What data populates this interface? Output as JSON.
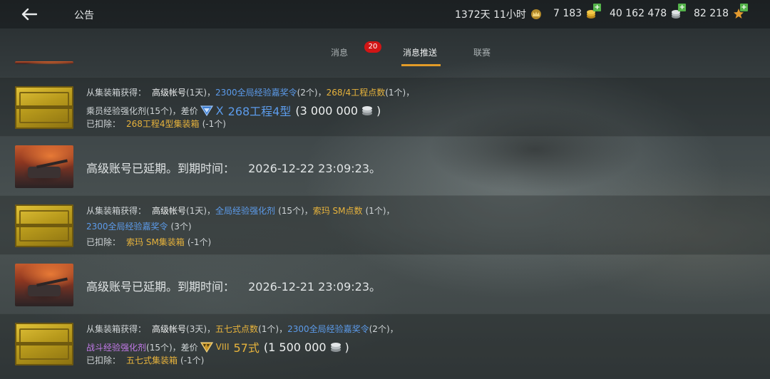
{
  "header": {
    "title": "公告",
    "time": "1372天 11小时",
    "gold": "7 183",
    "credits": "40 162 478",
    "free_xp": "82 218"
  },
  "tabs": [
    {
      "label": "消息",
      "badge": "20"
    },
    {
      "label": "消息推送"
    },
    {
      "label": "联赛"
    }
  ],
  "messages": [
    {
      "l1": {
        "from": "从集装箱获得：",
        "a": "高级帐号",
        "a_q": "(1天)",
        "sep1": "，",
        "b": "2300全局经验嘉奖令",
        "b_q": "(2个)",
        "sep2": "，",
        "c": "268/4工程点数",
        "c_q": "(1个)",
        "sep3": "，"
      },
      "l2": {
        "a": "乘员经验强化剂",
        "a_q": "(15个)",
        "diff": "，差价",
        "tier": "X",
        "tank": "268工程4型",
        "price": "(3 000 000",
        "close": ")"
      },
      "l3": {
        "label": "已扣除：",
        "item": "268工程4型集装箱",
        "q": "(-1个)"
      }
    },
    {
      "text": "高级账号已延期。到期时间：",
      "date": "2026-12-22 23:09:23。"
    },
    {
      "l1": {
        "from": "从集装箱获得：",
        "a": "高级帐号",
        "a_q": "(1天)",
        "sep1": "，",
        "b": "全局经验强化剂",
        "b_q": "(15个)",
        "sep2": "，",
        "c": "索玛 SM点数",
        "c_q": "(1个)",
        "sep3": "，"
      },
      "l2": {
        "a": "2300全局经验嘉奖令",
        "a_q": "(3个)"
      },
      "l3": {
        "label": "已扣除：",
        "item": "索玛 SM集装箱",
        "q": "(-1个)"
      }
    },
    {
      "text": "高级账号已延期。到期时间：",
      "date": "2026-12-21 23:09:23。"
    },
    {
      "l1": {
        "from": "从集装箱获得：",
        "a": "高级帐号",
        "a_q": "(3天)",
        "sep1": "，",
        "b": "五七式点数",
        "b_q": "(1个)",
        "sep2": "，",
        "c": "2300全局经验嘉奖令",
        "c_q": "(2个)",
        "sep3": "，"
      },
      "l2": {
        "a": "战斗经验强化剂",
        "a_q": "(15个)",
        "diff": "，差价",
        "tier": "VIII",
        "tank": "57式",
        "price": "(1 500 000",
        "close": ")"
      },
      "l3": {
        "label": "已扣除：",
        "item": "五七式集装箱",
        "q": "(-1个)"
      }
    }
  ],
  "colors": {
    "accent": "#e29b28",
    "badge": "#d11515",
    "gold_text": "#e7b33c",
    "blue_text": "#5c9bea",
    "purple_text": "#c27ae8"
  }
}
